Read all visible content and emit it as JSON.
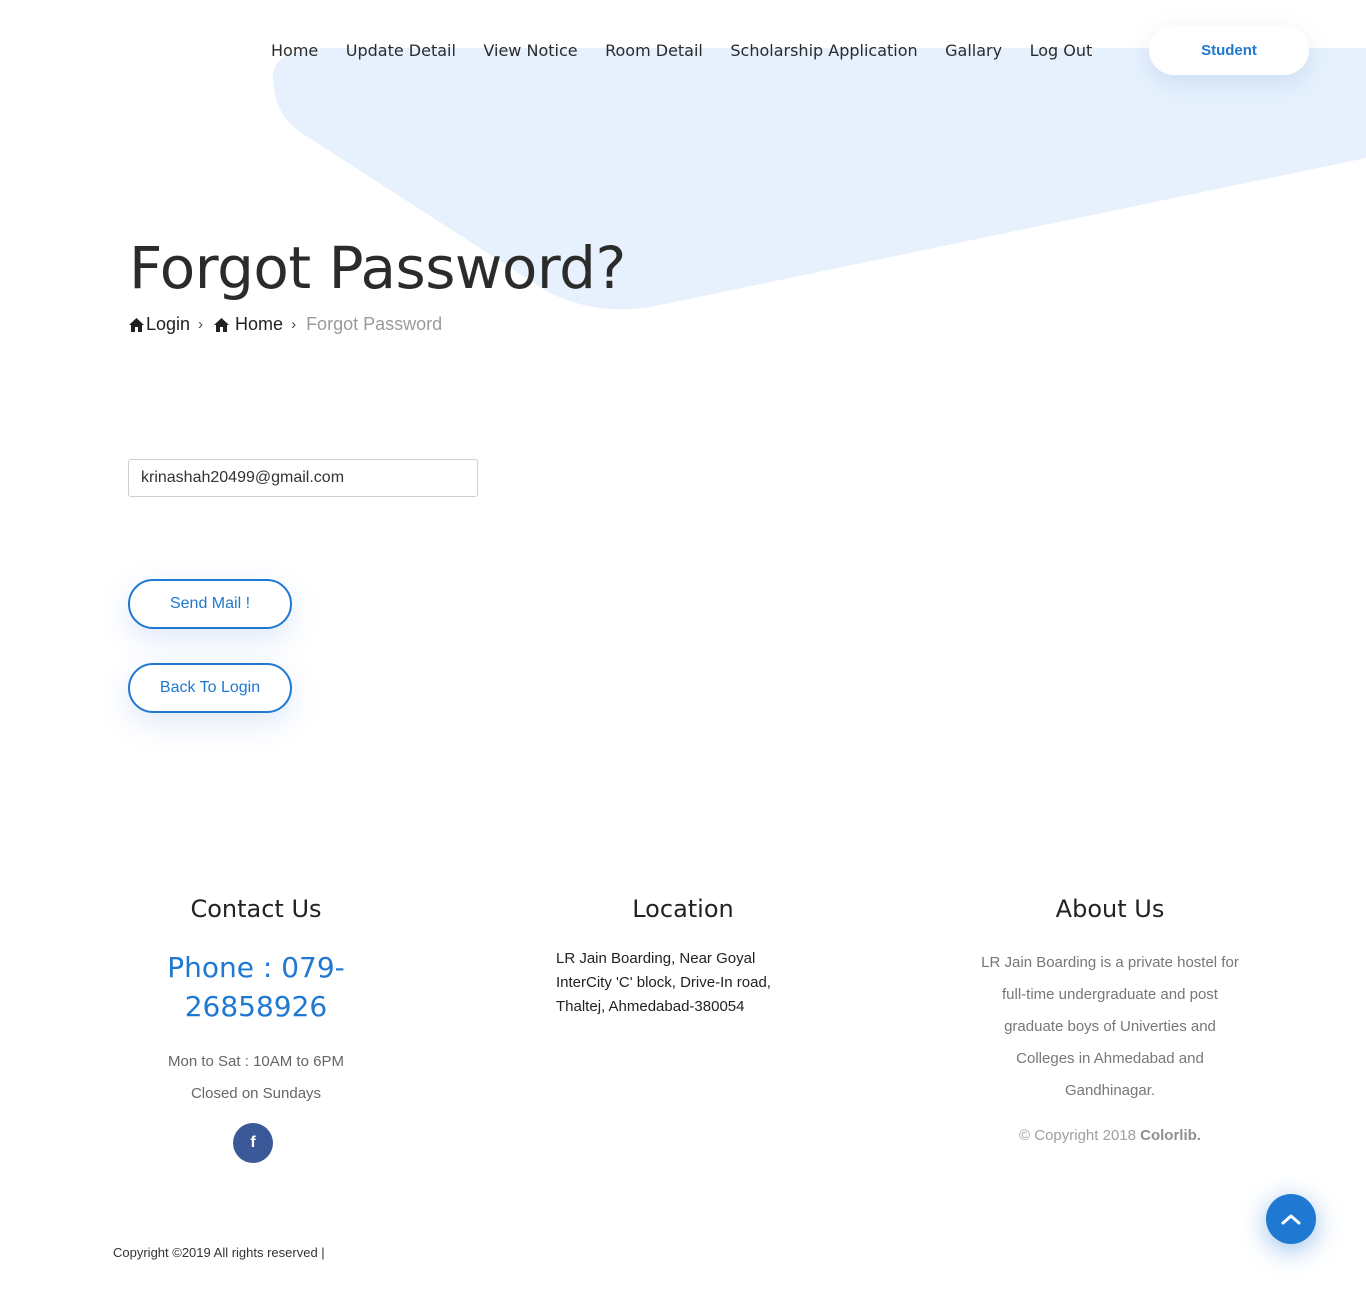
{
  "nav": {
    "items": [
      "Home",
      "Update Detail",
      "View Notice",
      "Room Detail",
      "Scholarship Application",
      "Gallary",
      "Log Out"
    ],
    "user_button": "Student"
  },
  "header": {
    "title": "Forgot Password?",
    "breadcrumb": [
      "Login",
      "Home",
      "Forgot Password"
    ]
  },
  "form": {
    "email_value": "krinashah20499@gmail.com",
    "send_label": "Send Mail !",
    "back_label": "Back To Login"
  },
  "footer": {
    "contact": {
      "heading": "Contact Us",
      "phone_line1": "Phone : 079-",
      "phone_line2": "26858926",
      "hours": "Mon to Sat : 10AM to 6PM",
      "closed": "Closed on Sundays"
    },
    "location": {
      "heading": "Location",
      "address": "LR Jain Boarding, Near Goyal InterCity 'C' block, Drive-In road, Thaltej, Ahmedabad-380054"
    },
    "about": {
      "heading": "About Us",
      "text": "LR Jain Boarding is a private hostel for full-time undergraduate and post graduate boys of Univerties and Colleges in Ahmedabad and Gandhinagar.",
      "copyright_prefix": "© Copyright 2018 ",
      "copyright_brand": "Colorlib."
    },
    "copyright": "Copyright ©2019 All rights reserved |"
  },
  "icons": {
    "breadcrumb": "home-icon",
    "social": "facebook-icon",
    "scroll": "chevron-up-icon"
  },
  "colors": {
    "accent": "#1f78d1",
    "blob": "#e6f1fd",
    "facebook": "#3b5998"
  }
}
